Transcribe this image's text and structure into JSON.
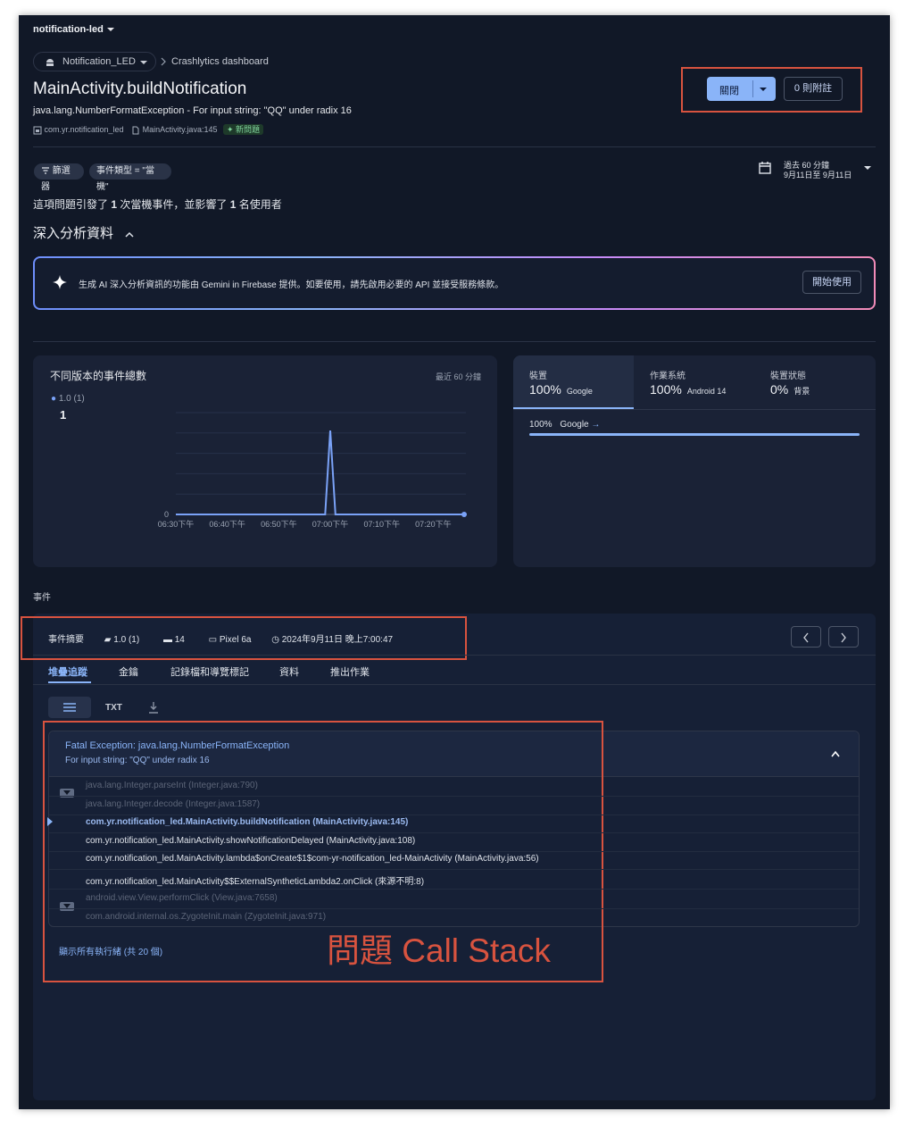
{
  "project": {
    "name": "notification-led"
  },
  "breadcrumb": {
    "app": "Notification_LED",
    "page": "Crashlytics dashboard"
  },
  "issue": {
    "title": "MainActivity.buildNotification",
    "exception": "java.lang.NumberFormatException - For input string: \"QQ\" under radix 16",
    "package": "com.yr.notification_led",
    "file": "MainActivity.java:145",
    "new_badge": "新問題"
  },
  "actions": {
    "close_label": "關閉",
    "notes_label": "0 則附註"
  },
  "filters": {
    "filter_label": "篩選器",
    "event_type": "事件類型 = \"當機\""
  },
  "time_range": {
    "line1": "過去 60 分鐘",
    "line2": "9月11日至 9月11日"
  },
  "summary": {
    "prefix": "這項問題引發了 ",
    "crashes": "1",
    "mid": " 次當機事件，並影響了 ",
    "users": "1",
    "suffix": " 名使用者"
  },
  "insights": {
    "heading": "深入分析資料",
    "gemini_text": "生成 AI 深入分析資訊的功能由 Gemini in Firebase 提供。如要使用，請先啟用必要的 API 並接受服務條款。",
    "start_button": "開始使用"
  },
  "chart_panel": {
    "title": "不同版本的事件總數",
    "range": "最近 60 分鐘",
    "legend": "1.0 (1)",
    "total": "1"
  },
  "chart_data": {
    "type": "line",
    "x_ticks": [
      "06:30下午",
      "06:40下午",
      "06:50下午",
      "07:00下午",
      "07:10下午",
      "07:20下午"
    ],
    "y_ticks": [
      "0"
    ],
    "series": [
      {
        "name": "1.0 (1)",
        "color": "#7aa2f7",
        "points": [
          {
            "x": "06:30下午",
            "y": 0
          },
          {
            "x": "06:59下午",
            "y": 0
          },
          {
            "x": "07:00下午",
            "y": 1
          },
          {
            "x": "07:01下午",
            "y": 0
          },
          {
            "x": "07:26下午",
            "y": 0
          }
        ]
      }
    ],
    "ylim": [
      0,
      1
    ],
    "grid": true
  },
  "breakdown": {
    "tabs": [
      {
        "label": "裝置",
        "pct": "100%",
        "value": "Google"
      },
      {
        "label": "作業系統",
        "pct": "100%",
        "value": "Android 14"
      },
      {
        "label": "裝置狀態",
        "pct": "0%",
        "value": "背景"
      }
    ],
    "row": {
      "pct": "100%",
      "name": "Google",
      "fill": 1.0
    }
  },
  "events": {
    "section_label": "事件",
    "summary_label": "事件摘要",
    "version": "1.0 (1)",
    "android": "14",
    "device": "Pixel 6a",
    "datetime": "2024年9月11日 晚上7:00:47",
    "tabs": [
      "堆疊追蹤",
      "金鑰",
      "記錄檔和導覽標記",
      "資料",
      "推出作業"
    ],
    "format_txt": "TXT"
  },
  "stack": {
    "title": "Fatal Exception: java.lang.NumberFormatException",
    "subtitle": "For input string: \"QQ\" under radix 16",
    "lines": [
      "java.lang.Integer.parseInt (Integer.java:790)",
      "java.lang.Integer.decode (Integer.java:1587)",
      "com.yr.notification_led.MainActivity.buildNotification (MainActivity.java:145)",
      "com.yr.notification_led.MainActivity.showNotificationDelayed (MainActivity.java:108)",
      "com.yr.notification_led.MainActivity.lambda$onCreate$1$com-yr-notification_led-MainActivity (MainActivity.java:56)",
      "com.yr.notification_led.MainActivity$$ExternalSyntheticLambda2.onClick (來源不明:8)",
      "android.view.View.performClick (View.java:7658)",
      "com.android.internal.os.ZygoteInit.main (ZygoteInit.java:971)"
    ],
    "show_all": "顯示所有執行緒 (共 20 個)"
  },
  "annotation": {
    "label": "問題 Call Stack",
    "color": "#d8533f"
  }
}
